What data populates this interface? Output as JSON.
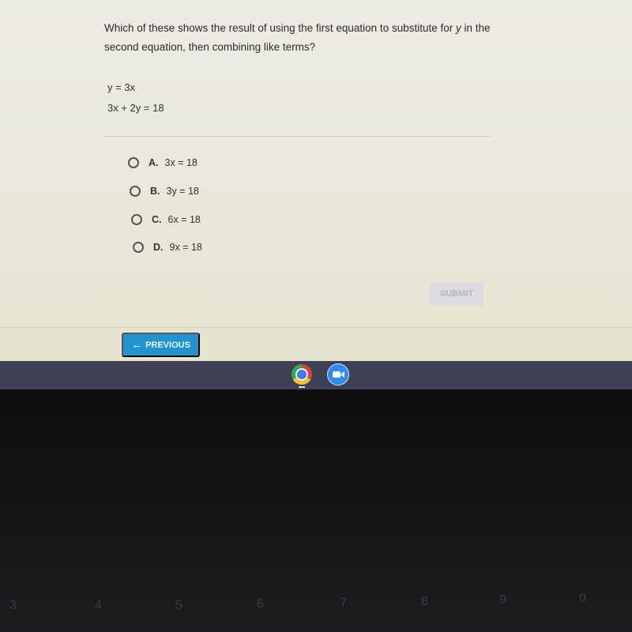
{
  "question": {
    "text_before_var": "Which of these shows the result of using the first equation to substitute for ",
    "variable": "y",
    "text_after_var": " in the second equation, then combining like terms?",
    "equations": [
      "y = 3x",
      "3x + 2y = 18"
    ]
  },
  "options": [
    {
      "letter": "A.",
      "text": "3x = 18"
    },
    {
      "letter": "B.",
      "text": "3y = 18"
    },
    {
      "letter": "C.",
      "text": "6x = 18"
    },
    {
      "letter": "D.",
      "text": "9x = 18"
    }
  ],
  "buttons": {
    "submit": "SUBMIT",
    "previous": "PREVIOUS",
    "previous_icon": "←"
  },
  "taskbar": {
    "apps": [
      "chrome-icon",
      "zoom-icon"
    ]
  },
  "keyboard": {
    "number_keys": [
      "3",
      "4",
      "5",
      "6",
      "7",
      "8",
      "9",
      "0"
    ]
  },
  "colors": {
    "accent": "#2394cf",
    "screen_bg": "#ecebe3",
    "taskbar": "#3e4155"
  }
}
